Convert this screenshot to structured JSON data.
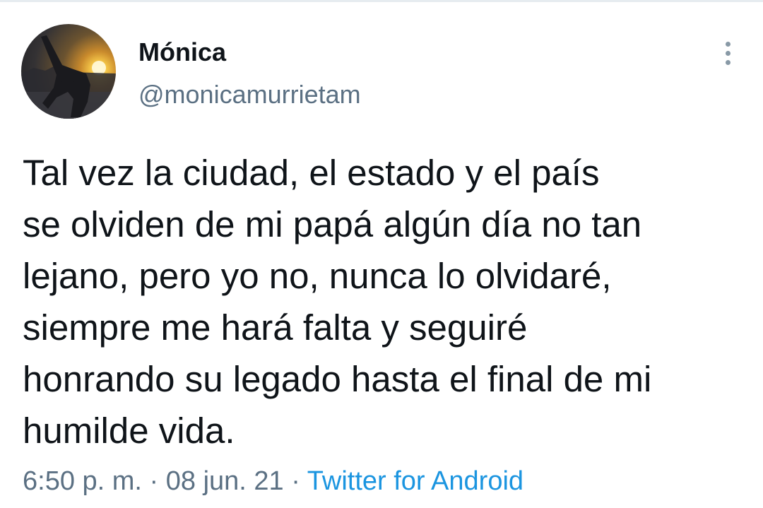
{
  "author": {
    "display_name": "Mónica",
    "handle": "@monicamurrietam",
    "avatar_icon": "avatar-photo"
  },
  "header": {
    "more_icon": "more-vertical-icon"
  },
  "tweet": {
    "lines": [
      "Tal vez la ciudad, el estado y el país",
      "se olviden de mi papá algún día no tan",
      "lejano, pero yo no, nunca lo olvidaré,",
      "siempre me hará falta y seguiré",
      "honrando su legado hasta el final de mi",
      "humilde vida."
    ]
  },
  "meta": {
    "time": "6:50 p. m.",
    "separator_1": " · ",
    "date": "08 jun. 21",
    "separator_2": " · ",
    "source": "Twitter for Android"
  },
  "colors": {
    "text": "#0f1419",
    "secondary": "#5b7083",
    "link": "#1b95e0"
  }
}
